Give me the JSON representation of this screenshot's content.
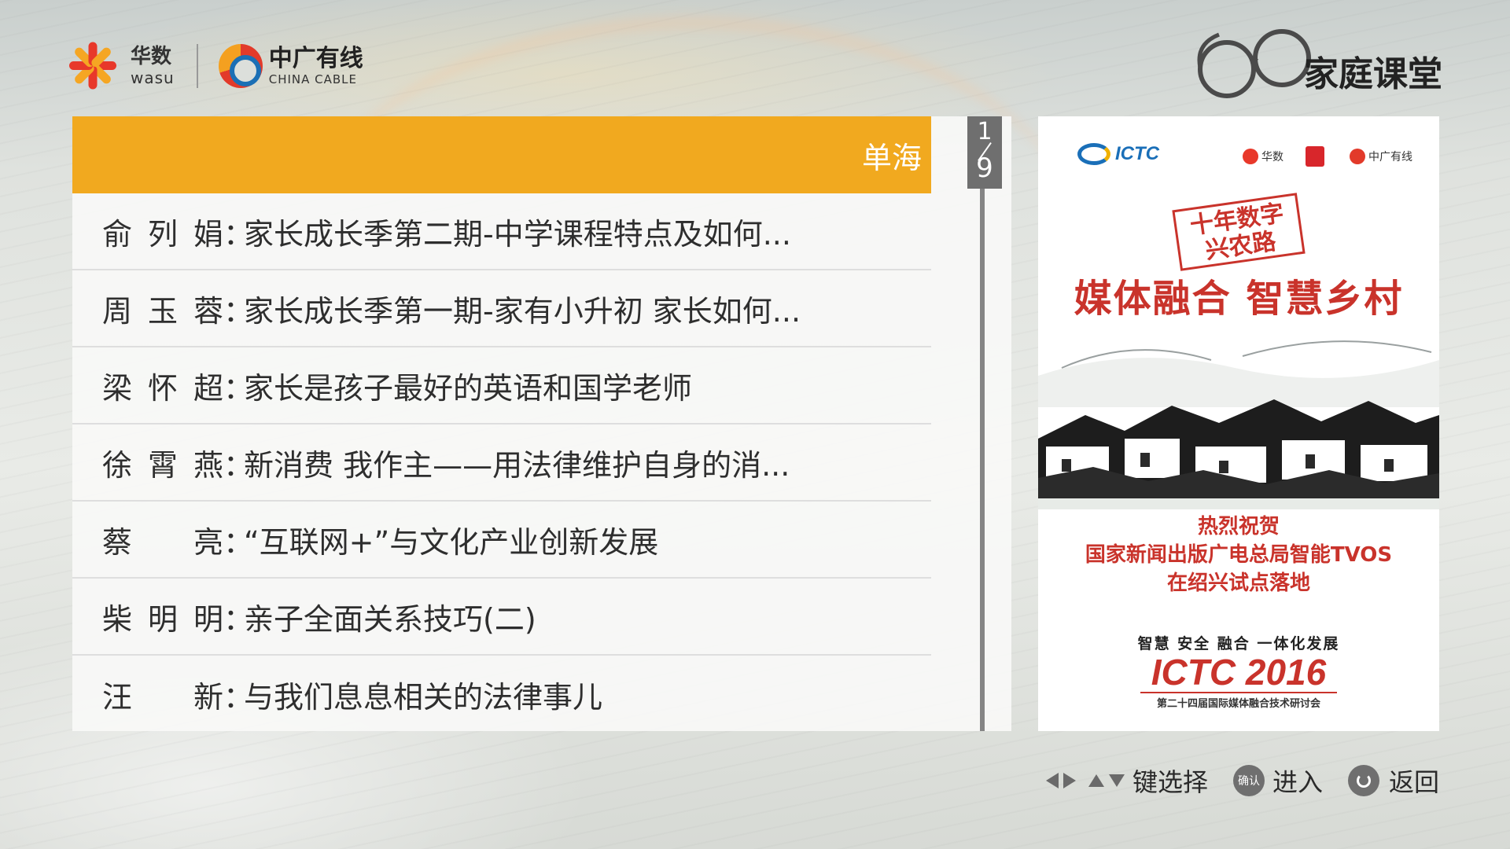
{
  "header": {
    "wasu_cn": "华数",
    "wasu_en": "wasu",
    "china_cable_cn": "中广有线",
    "china_cable_en": "CHINA CABLE",
    "page_title": "家庭课堂"
  },
  "list": {
    "items": [
      {
        "speaker": "",
        "colon": "",
        "title": "单海",
        "selected": true
      },
      {
        "speaker": "俞列娟",
        "colon": "：",
        "title": "家长成长季第二期-中学课程特点及如何..."
      },
      {
        "speaker": "周玉蓉",
        "colon": "：",
        "title": "家长成长季第一期-家有小升初 家长如何..."
      },
      {
        "speaker": "梁怀超",
        "colon": "：",
        "title": "家长是孩子最好的英语和国学老师"
      },
      {
        "speaker": "徐霄燕",
        "colon": "：",
        "title": "新消费 我作主——用法律维护自身的消..."
      },
      {
        "speaker": "蔡 亮",
        "colon": "：",
        "title": "“互联网+”与文化产业创新发展"
      },
      {
        "speaker": "柴明明",
        "colon": "：",
        "title": "亲子全面关系技巧(二)"
      },
      {
        "speaker": "汪 新",
        "colon": "：",
        "title": "与我们息息相关的法律事儿"
      }
    ],
    "page_current": "1",
    "page_total": "9"
  },
  "poster": {
    "ictc_logo": "ICTC",
    "mini_logo_1": "华数",
    "mini_logo_3": "中广有线",
    "calligraphy_small": "十年数字 兴农路",
    "calligraphy_main": "媒体融合 智慧乡村",
    "congrats_line1": "热烈祝贺",
    "congrats_line2": "国家新闻出版广电总局智能TVOS",
    "congrats_line3": "在绍兴试点落地",
    "tagline": "智慧 安全 融合 一体化发展",
    "ictc_title": "ICTC 2016",
    "subtitle": "第二十四届国际媒体融合技术研讨会"
  },
  "hints": {
    "select": "键选择",
    "ok_key": "确认",
    "enter": "进入",
    "back": "返回"
  },
  "colors": {
    "selected_bg": "#f1a91f",
    "poster_red": "#c9332b",
    "text_dark": "#2e2e2e"
  }
}
